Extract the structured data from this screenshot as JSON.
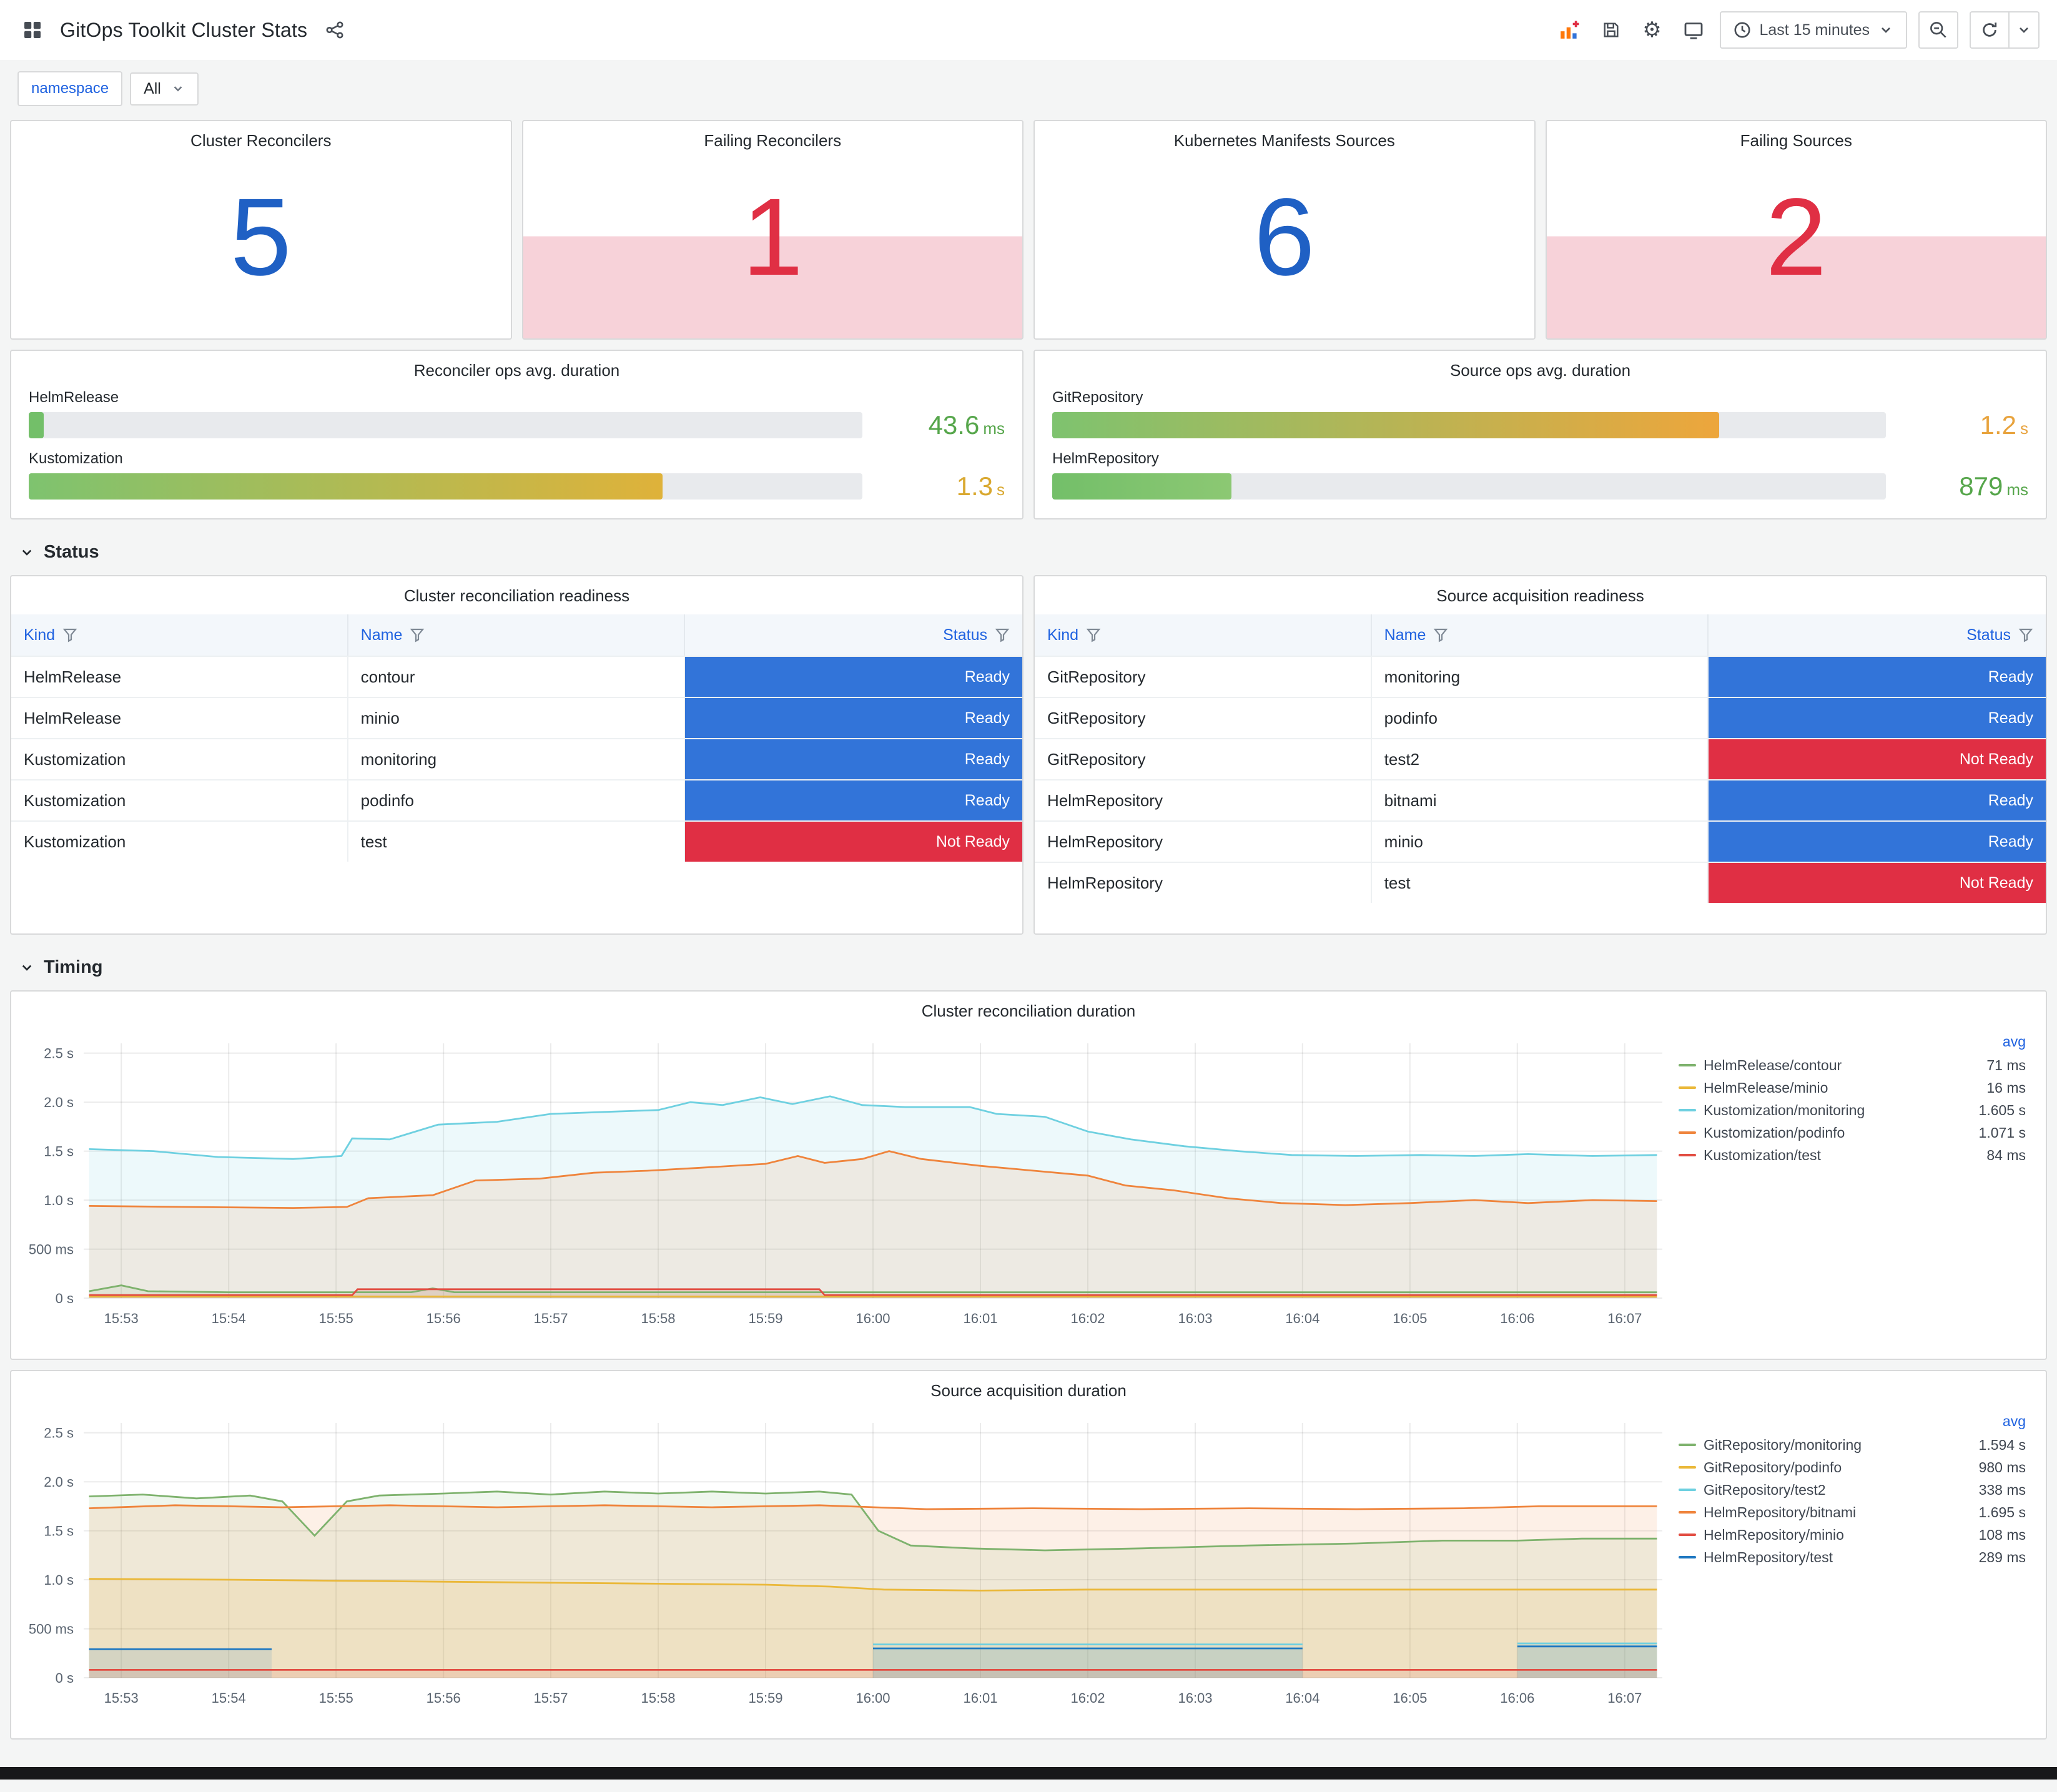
{
  "colors": {
    "ok": "#1F60C4",
    "alert": "#E02F44",
    "status_colors": {
      "Ready": "#3274D9",
      "Not Ready": "#E02F44"
    }
  },
  "icons": {
    "dashboard": "grid-squares",
    "share": "share-nodes",
    "add_panel": "bar-chart-plus",
    "save": "floppy-disk",
    "settings": "gear",
    "tv": "monitor",
    "clock": "clock",
    "zoom_out": "magnifier-minus",
    "refresh": "circular-arrow",
    "caret": "chevron-down",
    "filter": "funnel",
    "section_chevron": "chevron-down"
  },
  "header": {
    "title": "GitOps Toolkit Cluster Stats",
    "time_picker": "Last 15 minutes"
  },
  "variables": {
    "label": "namespace",
    "value": "All"
  },
  "sections": {
    "status": "Status",
    "timing": "Timing"
  },
  "stat_panels": [
    {
      "title": "Cluster Reconcilers",
      "value": "5",
      "status": "ok"
    },
    {
      "title": "Failing Reconcilers",
      "value": "1",
      "status": "alerting"
    },
    {
      "title": "Kubernetes Manifests Sources",
      "value": "6",
      "status": "ok"
    },
    {
      "title": "Failing Sources",
      "value": "2",
      "status": "alerting"
    }
  ],
  "gauge_panels": [
    {
      "title": "Reconciler ops avg. duration",
      "rows": [
        {
          "label": "HelmRelease",
          "value": "43.6",
          "unit": "ms",
          "pct": 1.8,
          "bar_from": "#73BF69",
          "bar_to": "#73BF69",
          "value_color": "#56A64B"
        },
        {
          "label": "Kustomization",
          "value": "1.3",
          "unit": "s",
          "pct": 76,
          "bar_from": "#7EC36F",
          "bar_to": "#DFB23A",
          "value_color": "#D9A82F"
        }
      ]
    },
    {
      "title": "Source ops avg. duration",
      "rows": [
        {
          "label": "GitRepository",
          "value": "1.2",
          "unit": "s",
          "pct": 80,
          "bar_from": "#7EC36F",
          "bar_to": "#EDA63C",
          "value_color": "#E8A33D"
        },
        {
          "label": "HelmRepository",
          "value": "879",
          "unit": "ms",
          "pct": 21.5,
          "bar_from": "#73BF69",
          "bar_to": "#8CC873",
          "value_color": "#56A64B"
        }
      ]
    }
  ],
  "table_panels": [
    {
      "title": "Cluster reconciliation readiness",
      "columns": [
        "Kind",
        "Name",
        "Status"
      ],
      "rows": [
        [
          "HelmRelease",
          "contour",
          "Ready"
        ],
        [
          "HelmRelease",
          "minio",
          "Ready"
        ],
        [
          "Kustomization",
          "monitoring",
          "Ready"
        ],
        [
          "Kustomization",
          "podinfo",
          "Ready"
        ],
        [
          "Kustomization",
          "test",
          "Not Ready"
        ]
      ]
    },
    {
      "title": "Source acquisition readiness",
      "columns": [
        "Kind",
        "Name",
        "Status"
      ],
      "rows": [
        [
          "GitRepository",
          "monitoring",
          "Ready"
        ],
        [
          "GitRepository",
          "podinfo",
          "Ready"
        ],
        [
          "GitRepository",
          "test2",
          "Not Ready"
        ],
        [
          "HelmRepository",
          "bitnami",
          "Ready"
        ],
        [
          "HelmRepository",
          "minio",
          "Ready"
        ],
        [
          "HelmRepository",
          "test",
          "Not Ready"
        ]
      ]
    }
  ],
  "chart_data": [
    {
      "type": "line",
      "title": "Cluster reconciliation duration",
      "ylim": [
        0,
        2.5
      ],
      "legend_header": "avg",
      "yticks": [
        {
          "v": 0,
          "label": "0 s"
        },
        {
          "v": 0.5,
          "label": "500 ms"
        },
        {
          "v": 1,
          "label": "1.0 s"
        },
        {
          "v": 1.5,
          "label": "1.5 s"
        },
        {
          "v": 2,
          "label": "2.0 s"
        },
        {
          "v": 2.5,
          "label": "2.5 s"
        }
      ],
      "xticks": [
        "15:53",
        "15:54",
        "15:55",
        "15:56",
        "15:57",
        "15:58",
        "15:59",
        "16:00",
        "16:01",
        "16:02",
        "16:03",
        "16:04",
        "16:05",
        "16:06",
        "16:07"
      ],
      "series": [
        {
          "name": "HelmRelease/contour",
          "color": "#7EB26D",
          "avg": "71 ms",
          "points": [
            [
              -0.3,
              0.07
            ],
            [
              0,
              0.13
            ],
            [
              0.25,
              0.07
            ],
            [
              1,
              0.06
            ],
            [
              2.7,
              0.06
            ],
            [
              2.9,
              0.1
            ],
            [
              3.1,
              0.06
            ],
            [
              5,
              0.06
            ],
            [
              8,
              0.06
            ],
            [
              11,
              0.06
            ],
            [
              14.3,
              0.06
            ]
          ]
        },
        {
          "name": "HelmRelease/minio",
          "color": "#EAB839",
          "avg": "16 ms",
          "points": [
            [
              -0.3,
              0.016
            ],
            [
              14.3,
              0.016
            ]
          ]
        },
        {
          "name": "Kustomization/monitoring",
          "color": "#6ED0E0",
          "avg": "1.605 s",
          "points": [
            [
              -0.3,
              1.52
            ],
            [
              0.3,
              1.5
            ],
            [
              0.9,
              1.44
            ],
            [
              1.6,
              1.42
            ],
            [
              2.05,
              1.45
            ],
            [
              2.15,
              1.63
            ],
            [
              2.5,
              1.62
            ],
            [
              2.95,
              1.77
            ],
            [
              3.5,
              1.8
            ],
            [
              4,
              1.88
            ],
            [
              4.5,
              1.9
            ],
            [
              5,
              1.92
            ],
            [
              5.3,
              2.0
            ],
            [
              5.6,
              1.97
            ],
            [
              5.95,
              2.05
            ],
            [
              6.25,
              1.98
            ],
            [
              6.6,
              2.06
            ],
            [
              6.9,
              1.97
            ],
            [
              7.3,
              1.95
            ],
            [
              7.9,
              1.95
            ],
            [
              8.15,
              1.88
            ],
            [
              8.6,
              1.85
            ],
            [
              9,
              1.7
            ],
            [
              9.4,
              1.62
            ],
            [
              9.9,
              1.55
            ],
            [
              10.4,
              1.5
            ],
            [
              10.9,
              1.46
            ],
            [
              11.5,
              1.45
            ],
            [
              12.1,
              1.46
            ],
            [
              12.6,
              1.45
            ],
            [
              13.1,
              1.47
            ],
            [
              13.7,
              1.45
            ],
            [
              14.3,
              1.46
            ]
          ]
        },
        {
          "name": "Kustomization/podinfo",
          "color": "#EF843C",
          "avg": "1.071 s",
          "points": [
            [
              -0.3,
              0.94
            ],
            [
              0.6,
              0.93
            ],
            [
              1.6,
              0.92
            ],
            [
              2.1,
              0.93
            ],
            [
              2.3,
              1.02
            ],
            [
              2.9,
              1.05
            ],
            [
              3.3,
              1.2
            ],
            [
              3.9,
              1.22
            ],
            [
              4.4,
              1.28
            ],
            [
              4.9,
              1.3
            ],
            [
              5.4,
              1.33
            ],
            [
              6,
              1.37
            ],
            [
              6.3,
              1.45
            ],
            [
              6.55,
              1.38
            ],
            [
              6.9,
              1.42
            ],
            [
              7.15,
              1.5
            ],
            [
              7.45,
              1.42
            ],
            [
              8,
              1.35
            ],
            [
              8.5,
              1.3
            ],
            [
              9,
              1.25
            ],
            [
              9.35,
              1.15
            ],
            [
              9.8,
              1.1
            ],
            [
              10.3,
              1.02
            ],
            [
              10.8,
              0.97
            ],
            [
              11.4,
              0.95
            ],
            [
              12,
              0.97
            ],
            [
              12.6,
              1.0
            ],
            [
              13.1,
              0.97
            ],
            [
              13.7,
              1.0
            ],
            [
              14.3,
              0.99
            ]
          ]
        },
        {
          "name": "Kustomization/test",
          "color": "#E24D42",
          "avg": "84 ms",
          "points": [
            [
              -0.3,
              0.03
            ],
            [
              2.15,
              0.03
            ],
            [
              2.2,
              0.09
            ],
            [
              6.5,
              0.09
            ],
            [
              6.55,
              0.03
            ],
            [
              14.3,
              0.03
            ]
          ]
        }
      ]
    },
    {
      "type": "line",
      "title": "Source acquisition duration",
      "ylim": [
        0,
        2.5
      ],
      "legend_header": "avg",
      "yticks": [
        {
          "v": 0,
          "label": "0 s"
        },
        {
          "v": 0.5,
          "label": "500 ms"
        },
        {
          "v": 1,
          "label": "1.0 s"
        },
        {
          "v": 1.5,
          "label": "1.5 s"
        },
        {
          "v": 2,
          "label": "2.0 s"
        },
        {
          "v": 2.5,
          "label": "2.5 s"
        }
      ],
      "xticks": [
        "15:53",
        "15:54",
        "15:55",
        "15:56",
        "15:57",
        "15:58",
        "15:59",
        "16:00",
        "16:01",
        "16:02",
        "16:03",
        "16:04",
        "16:05",
        "16:06",
        "16:07"
      ],
      "series": [
        {
          "name": "GitRepository/monitoring",
          "color": "#7EB26D",
          "avg": "1.594 s",
          "points": [
            [
              -0.3,
              1.85
            ],
            [
              0.2,
              1.87
            ],
            [
              0.7,
              1.83
            ],
            [
              1.2,
              1.86
            ],
            [
              1.5,
              1.8
            ],
            [
              1.8,
              1.45
            ],
            [
              2.1,
              1.8
            ],
            [
              2.4,
              1.86
            ],
            [
              3,
              1.88
            ],
            [
              3.5,
              1.9
            ],
            [
              4,
              1.87
            ],
            [
              4.5,
              1.9
            ],
            [
              5,
              1.88
            ],
            [
              5.5,
              1.9
            ],
            [
              6,
              1.88
            ],
            [
              6.5,
              1.9
            ],
            [
              6.8,
              1.87
            ],
            [
              7.05,
              1.5
            ],
            [
              7.35,
              1.35
            ],
            [
              7.9,
              1.32
            ],
            [
              8.6,
              1.3
            ],
            [
              9.5,
              1.32
            ],
            [
              10.5,
              1.35
            ],
            [
              11.5,
              1.37
            ],
            [
              12.3,
              1.4
            ],
            [
              13,
              1.4
            ],
            [
              13.6,
              1.42
            ],
            [
              14.3,
              1.42
            ]
          ]
        },
        {
          "name": "GitRepository/podinfo",
          "color": "#EAB839",
          "avg": "980 ms",
          "points": [
            [
              -0.3,
              1.01
            ],
            [
              1,
              1.0
            ],
            [
              2,
              0.99
            ],
            [
              3,
              0.98
            ],
            [
              4,
              0.97
            ],
            [
              5,
              0.96
            ],
            [
              6,
              0.95
            ],
            [
              6.6,
              0.93
            ],
            [
              7.1,
              0.9
            ],
            [
              8,
              0.89
            ],
            [
              9,
              0.9
            ],
            [
              10.2,
              0.9
            ],
            [
              11.4,
              0.9
            ],
            [
              12.6,
              0.9
            ],
            [
              14.3,
              0.9
            ]
          ]
        },
        {
          "name": "GitRepository/test2",
          "color": "#6ED0E0",
          "avg": "338 ms",
          "points": [
            [
              7,
              0.34
            ],
            [
              8.3,
              0.34
            ],
            [
              9.6,
              0.34
            ],
            [
              11,
              0.34
            ],
            null,
            [
              13,
              0.35
            ],
            [
              14.3,
              0.35
            ]
          ]
        },
        {
          "name": "HelmRepository/bitnami",
          "color": "#EF843C",
          "avg": "1.695 s",
          "points": [
            [
              -0.3,
              1.73
            ],
            [
              0.5,
              1.76
            ],
            [
              1.5,
              1.74
            ],
            [
              2.5,
              1.76
            ],
            [
              3.5,
              1.74
            ],
            [
              4.5,
              1.76
            ],
            [
              5.5,
              1.74
            ],
            [
              6.5,
              1.76
            ],
            [
              7.5,
              1.72
            ],
            [
              8.5,
              1.73
            ],
            [
              9.5,
              1.72
            ],
            [
              10.5,
              1.73
            ],
            [
              11.5,
              1.72
            ],
            [
              12.5,
              1.73
            ],
            [
              13.2,
              1.75
            ],
            [
              14.3,
              1.75
            ]
          ]
        },
        {
          "name": "HelmRepository/minio",
          "color": "#E24D42",
          "avg": "108 ms",
          "points": [
            [
              -0.3,
              0.08
            ],
            [
              14.3,
              0.08
            ]
          ]
        },
        {
          "name": "HelmRepository/test",
          "color": "#1F78C1",
          "avg": "289 ms",
          "points": [
            [
              -0.3,
              0.29
            ],
            [
              1.4,
              0.29
            ],
            null,
            [
              7,
              0.3
            ],
            [
              11,
              0.3
            ],
            null,
            [
              13,
              0.32
            ],
            [
              14.3,
              0.32
            ]
          ]
        }
      ]
    }
  ]
}
